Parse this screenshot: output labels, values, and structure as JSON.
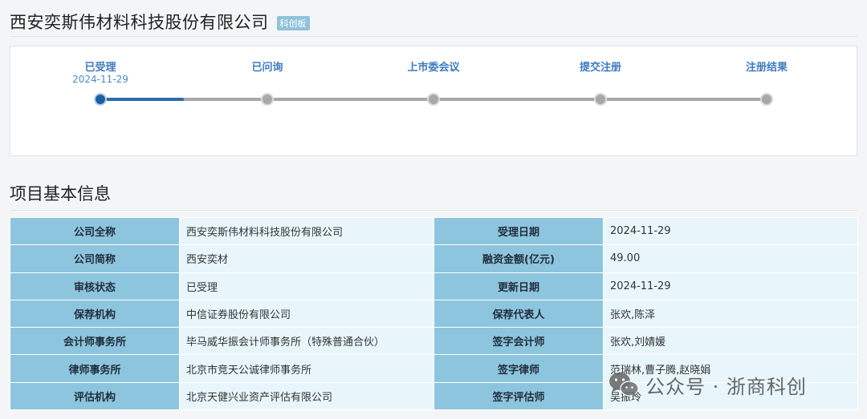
{
  "header": {
    "company_name": "西安奕斯伟材料科技股份有限公司",
    "board_badge": "科创板"
  },
  "progress": {
    "steps": [
      {
        "label": "已受理",
        "date": "2024-11-29",
        "status": "active"
      },
      {
        "label": "已问询",
        "date": "",
        "status": "pending"
      },
      {
        "label": "上市委会议",
        "date": "",
        "status": "pending"
      },
      {
        "label": "提交注册",
        "date": "",
        "status": "pending"
      },
      {
        "label": "注册结果",
        "date": "",
        "status": "pending"
      }
    ],
    "colors": {
      "active": "#1d5fa3",
      "pending": "#a8a8a8",
      "label": "#3d7bbf"
    }
  },
  "section": {
    "title": "项目基本信息"
  },
  "table": {
    "rows": [
      {
        "label1": "公司全称",
        "value1": "西安奕斯伟材料科技股份有限公司",
        "label2": "受理日期",
        "value2": "2024-11-29"
      },
      {
        "label1": "公司简称",
        "value1": "西安奕材",
        "label2": "融资金额(亿元)",
        "value2": "49.00"
      },
      {
        "label1": "审核状态",
        "value1": "已受理",
        "label2": "更新日期",
        "value2": "2024-11-29"
      },
      {
        "label1": "保荐机构",
        "value1": "中信证券股份有限公司",
        "label2": "保荐代表人",
        "value2": "张欢,陈泽"
      },
      {
        "label1": "会计师事务所",
        "value1": "毕马威华振会计师事务所（特殊普通合伙）",
        "label2": "签字会计师",
        "value2": "张欢,刘婧媛"
      },
      {
        "label1": "律师事务所",
        "value1": "北京市竞天公诚律师事务所",
        "label2": "签字律师",
        "value2": "范瑞林,曹子腾,赵晓娟"
      },
      {
        "label1": "评估机构",
        "value1": "北京天健兴业资产评估有限公司",
        "label2": "签字评估师",
        "value2": "吴振玲"
      }
    ],
    "colors": {
      "label_bg": "#8ec5de",
      "value_bg": "#e8f6fb"
    }
  },
  "watermark": {
    "icon": "wechat-icon",
    "text": "公众号 · 浙商科创"
  }
}
